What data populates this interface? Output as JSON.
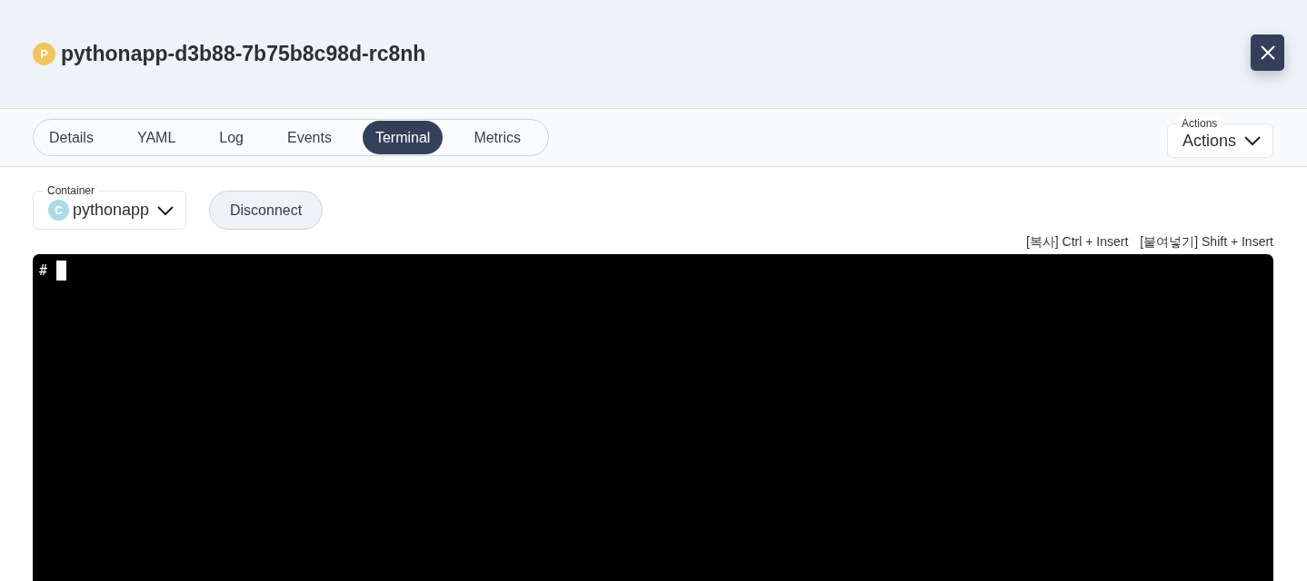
{
  "header": {
    "badge": "P",
    "title": "pythonapp-d3b88-7b75b8c98d-rc8nh"
  },
  "tabs": [
    {
      "label": "Details",
      "selected": false
    },
    {
      "label": "YAML",
      "selected": false
    },
    {
      "label": "Log",
      "selected": false
    },
    {
      "label": "Events",
      "selected": false
    },
    {
      "label": "Terminal",
      "selected": true
    },
    {
      "label": "Metrics",
      "selected": false
    }
  ],
  "actions": {
    "label": "Actions",
    "value": "Actions"
  },
  "container": {
    "label": "Container",
    "badge": "C",
    "value": "pythonapp"
  },
  "disconnect_button": "Disconnect",
  "shortcuts": [
    "[복사] Ctrl + Insert",
    "[붙여넣기] Shift + Insert"
  ],
  "terminal": {
    "prompt": "#"
  }
}
